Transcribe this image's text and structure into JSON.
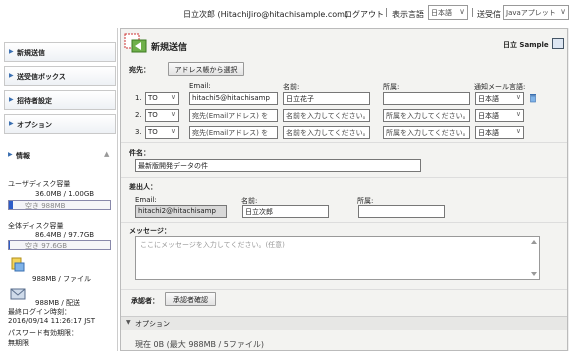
{
  "header": {
    "user": "日立次郎 (HitachiJiro@hitachisample.com)",
    "logout": "ログアウト",
    "language_label": "表示言語",
    "language_value": "日本語",
    "send_label": "送受信",
    "send_value": "Javaアプレット"
  },
  "sidebar": {
    "items": [
      {
        "label": "新規送信"
      },
      {
        "label": "送受信ボックス"
      },
      {
        "label": "招待者設定"
      },
      {
        "label": "オプション"
      }
    ],
    "info_title": "情報",
    "user_disk_label": "ユーザディスク容量",
    "user_disk_usage": "36.0MB / 1.00GB",
    "user_disk_free": "空き 988MB",
    "user_disk_fraction": 0.035,
    "all_disk_label": "全体ディスク容量",
    "all_disk_usage": "86.4MB / 97.7GB",
    "all_disk_free": "空き 97.6GB",
    "all_disk_fraction": 0.01,
    "file_limit": "988MB / ファイル",
    "delivery_limit": "988MB / 配送",
    "last_login_label": "最終ログイン時刻：",
    "last_login_value": "2016/09/14 11:26:17 JST",
    "pw_expiry_label": "パスワード有効期限：",
    "pw_expiry_value": "無期限"
  },
  "panel": {
    "title": "新規送信",
    "company": "日立 Sample",
    "to_section": "宛先：",
    "address_book_button": "アドレス帳から選択",
    "col_email": "Email:",
    "col_name": "名前:",
    "col_org": "所属:",
    "col_notify": "通知メール言語:",
    "recipients": [
      {
        "num": "1.",
        "type": "TO",
        "email": "hitachi5@hitachisamp",
        "name": "日立花子",
        "org": "",
        "lang": "日本語"
      },
      {
        "num": "2.",
        "type": "TO",
        "email": "宛先(Emailアドレス) を",
        "name": "名前を入力してください。",
        "org": "所属を入力してください。",
        "lang": "日本語"
      },
      {
        "num": "3.",
        "type": "TO",
        "email": "宛先(Emailアドレス) を",
        "name": "名前を入力してください。",
        "org": "所属を入力してください。",
        "lang": "日本語"
      }
    ],
    "subject_label": "件名：",
    "subject_value": "最新版開発データの件",
    "sender_section": "差出人：",
    "sender_email_label": "Email:",
    "sender_email": "hitachi2@hitachisamp",
    "sender_name_label": "名前:",
    "sender_name": "日立次郎",
    "sender_org_label": "所属:",
    "sender_org": "",
    "message_label": "メッセージ：",
    "message_placeholder": "ここにメッセージを入力してください。(任意)",
    "approver_label": "承認者：",
    "approver_button": "承認者確認",
    "options_label": "オプション",
    "footer_text": "現在 0B (最大 988MB / 5ファイル)"
  }
}
